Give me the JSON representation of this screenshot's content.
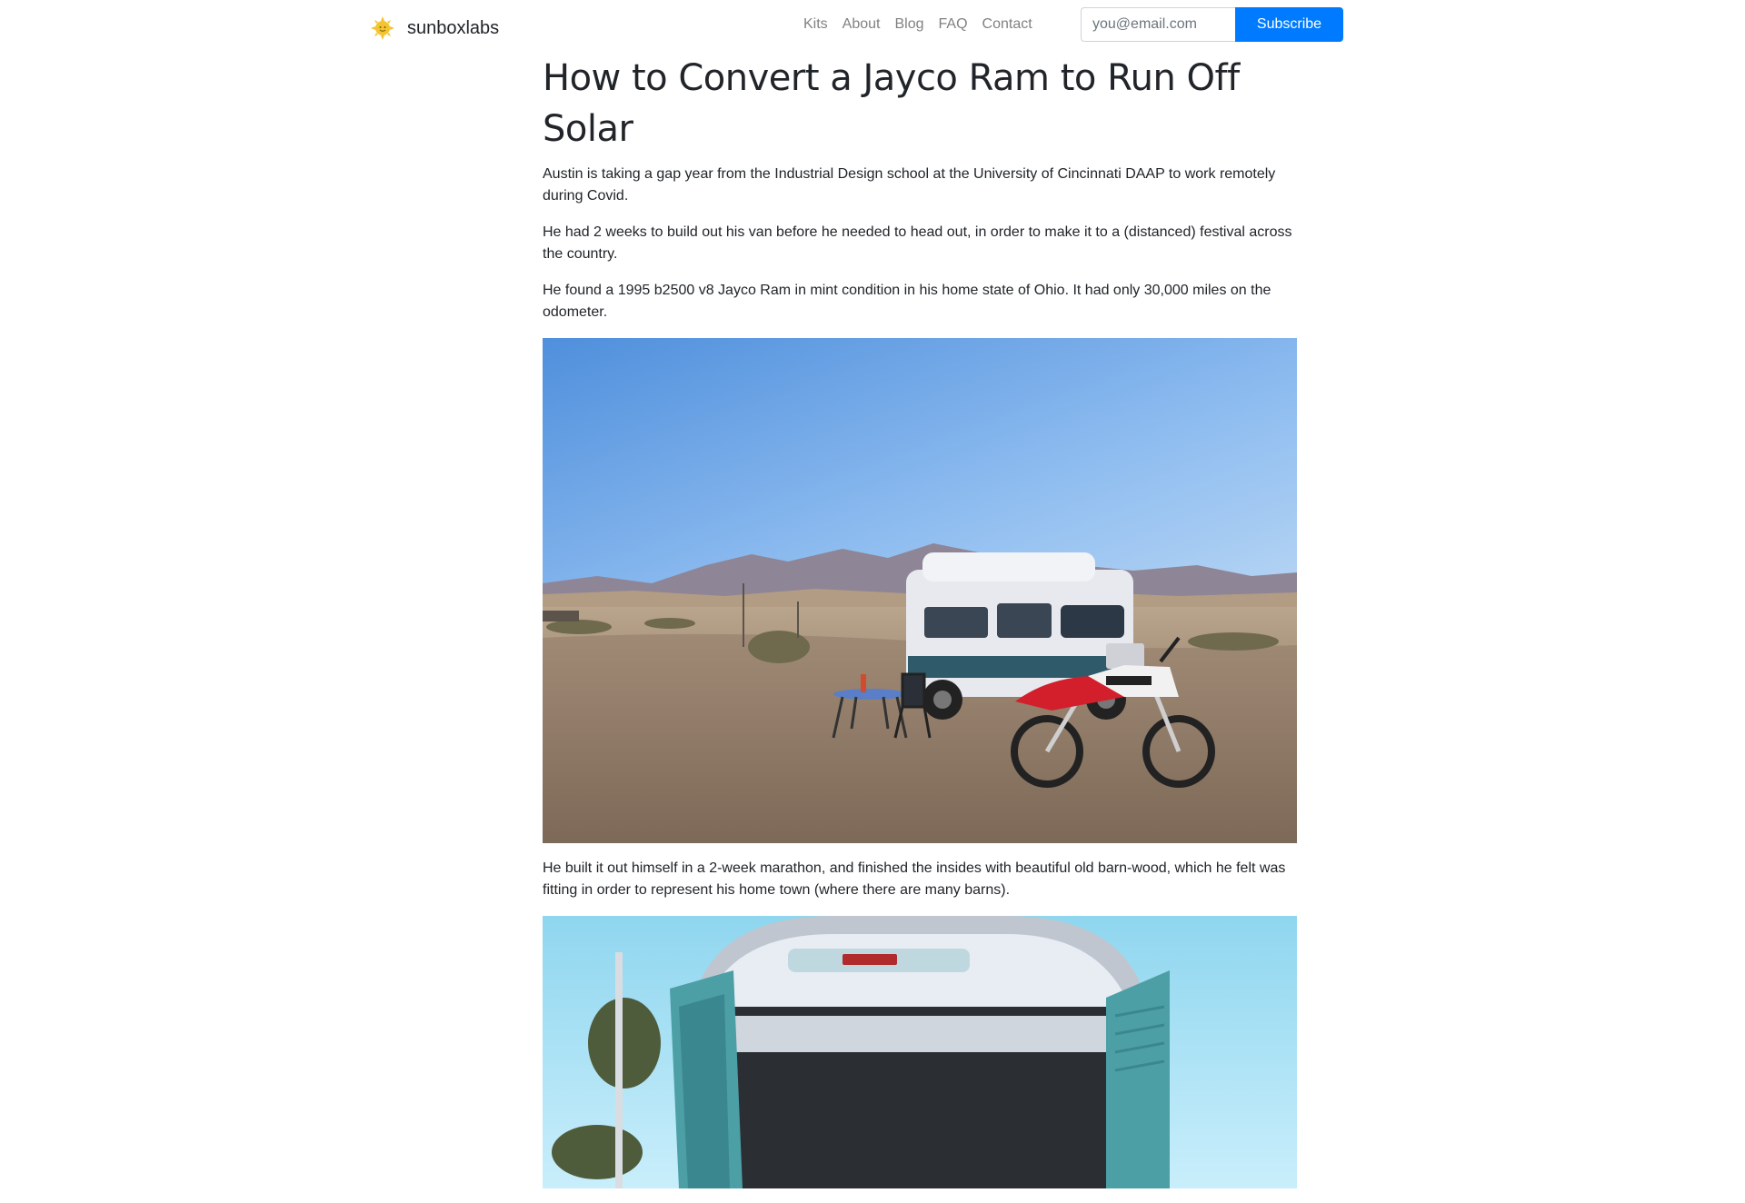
{
  "brand": {
    "name": "sunboxlabs",
    "icon": "sun-icon",
    "icon_color": "#f4c430"
  },
  "nav": {
    "items": [
      {
        "label": "Kits"
      },
      {
        "label": "About"
      },
      {
        "label": "Blog"
      },
      {
        "label": "FAQ"
      },
      {
        "label": "Contact"
      }
    ]
  },
  "subscribe": {
    "placeholder": "you@email.com",
    "button_label": "Subscribe",
    "button_color": "#007bff"
  },
  "article": {
    "title": "How to Convert a Jayco Ram to Run Off Solar",
    "paragraphs": [
      "Austin is taking a gap year from the Industrial Design school at the University of Cincinnati DAAP to work remotely during Covid.",
      "He had 2 weeks to build out his van before he needed to head out, in order to make it to a (distanced) festival across the country.",
      "He found a 1995 b2500 v8 Jayco Ram in mint condition in his home state of Ohio. It had only 30,000 miles on the odometer.",
      "He built it out himself in a 2-week marathon, and finished the insides with beautiful old barn-wood, which he felt was fitting in order to represent his home town (where there are many barns)."
    ]
  }
}
